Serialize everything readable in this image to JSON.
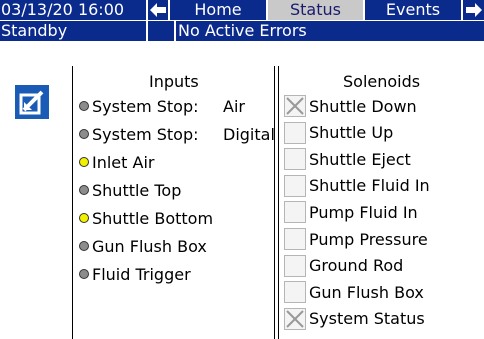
{
  "header": {
    "datetime": "03/13/20 16:00",
    "tabs": [
      {
        "label": "Home",
        "selected": false
      },
      {
        "label": "Status",
        "selected": true
      },
      {
        "label": "Events",
        "selected": false
      }
    ],
    "left_arrow_icon": "arrow-left-icon",
    "right_arrow_icon": "arrow-right-icon"
  },
  "status_bar": {
    "mode": "Standby",
    "errors": "No Active Errors"
  },
  "edit_icon": "edit-checkbox-icon",
  "inputs": {
    "title": "Inputs",
    "items": [
      {
        "label": "System Stop:",
        "value": "Air",
        "active": false
      },
      {
        "label": "System Stop:",
        "value": "Digital",
        "active": false
      },
      {
        "label": "Inlet Air",
        "value": "",
        "active": true
      },
      {
        "label": "Shuttle Top",
        "value": "",
        "active": false
      },
      {
        "label": "Shuttle Bottom",
        "value": "",
        "active": true
      },
      {
        "label": "Gun Flush Box",
        "value": "",
        "active": false
      },
      {
        "label": "Fluid Trigger",
        "value": "",
        "active": false
      }
    ]
  },
  "solenoids": {
    "title": "Solenoids",
    "items": [
      {
        "label": "Shuttle Down",
        "checked": true
      },
      {
        "label": "Shuttle Up",
        "checked": false
      },
      {
        "label": "Shuttle Eject",
        "checked": false
      },
      {
        "label": "Shuttle Fluid In",
        "checked": false
      },
      {
        "label": "Pump Fluid In",
        "checked": false
      },
      {
        "label": "Pump Pressure",
        "checked": false
      },
      {
        "label": "Ground Rod",
        "checked": false
      },
      {
        "label": "Gun Flush Box",
        "checked": false
      },
      {
        "label": "System Status",
        "checked": true
      }
    ]
  },
  "colors": {
    "navy": "#0a2a8c",
    "tab_selected": "#c9c9c9",
    "led_on": "#f2f200",
    "led_off": "#8c8c8c",
    "icon_bg": "#1a5bb5"
  }
}
